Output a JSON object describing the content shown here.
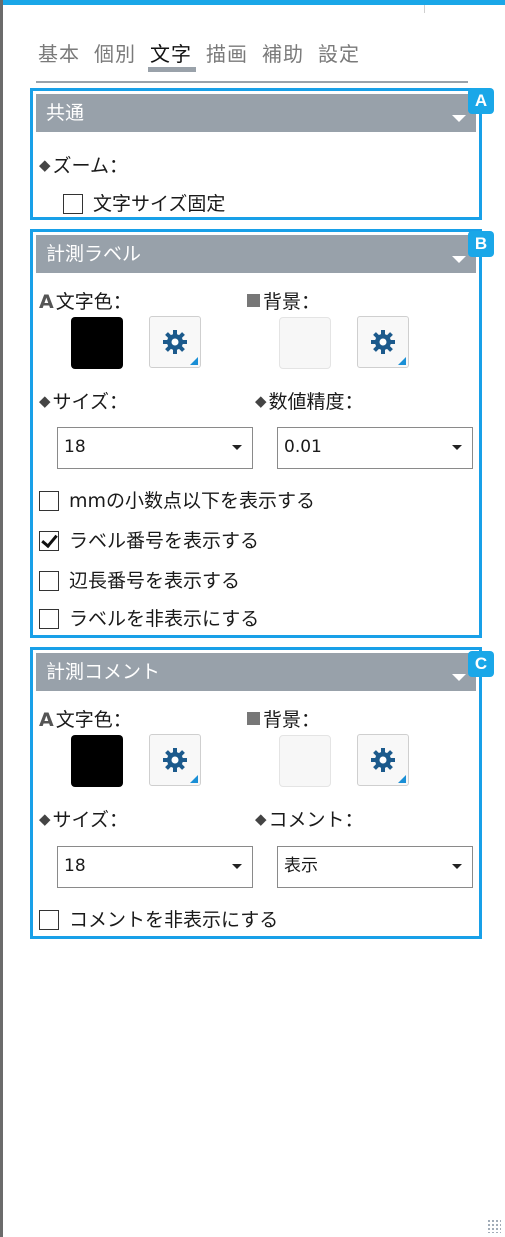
{
  "tabs": [
    "基本",
    "個別",
    "文字",
    "描画",
    "補助",
    "設定"
  ],
  "active_tab": "文字",
  "panels": {
    "A": {
      "badge": "A",
      "title": "共通",
      "zoom_label": "ズーム：",
      "fixed_size_label": "文字サイズ固定",
      "fixed_size_checked": false
    },
    "B": {
      "badge": "B",
      "title": "計測ラベル",
      "text_color_label": "文字色：",
      "background_label": "背景：",
      "text_color": "#000000",
      "size_label": "サイズ：",
      "precision_label": "数値精度：",
      "size_value": "18",
      "precision_value": "0.01",
      "options": [
        {
          "label": "mmの小数点以下を表示する",
          "checked": false
        },
        {
          "label": "ラベル番号を表示する",
          "checked": true
        },
        {
          "label": "辺長番号を表示する",
          "checked": false
        },
        {
          "label": "ラベルを非表示にする",
          "checked": false
        }
      ]
    },
    "C": {
      "badge": "C",
      "title": "計測コメント",
      "text_color_label": "文字色：",
      "background_label": "背景：",
      "text_color": "#000000",
      "size_label": "サイズ：",
      "comment_label": "コメント：",
      "size_value": "18",
      "comment_value": "表示",
      "hide_label": "コメントを非表示にする",
      "hide_checked": false
    }
  },
  "icons": {
    "dropdown": "triangle-down-icon",
    "settings": "gear-icon",
    "resize": "resize-grip-icon"
  },
  "colors": {
    "accent": "#1aa7e8",
    "header": "#98a1aa",
    "gear": "#1c5a8c"
  }
}
